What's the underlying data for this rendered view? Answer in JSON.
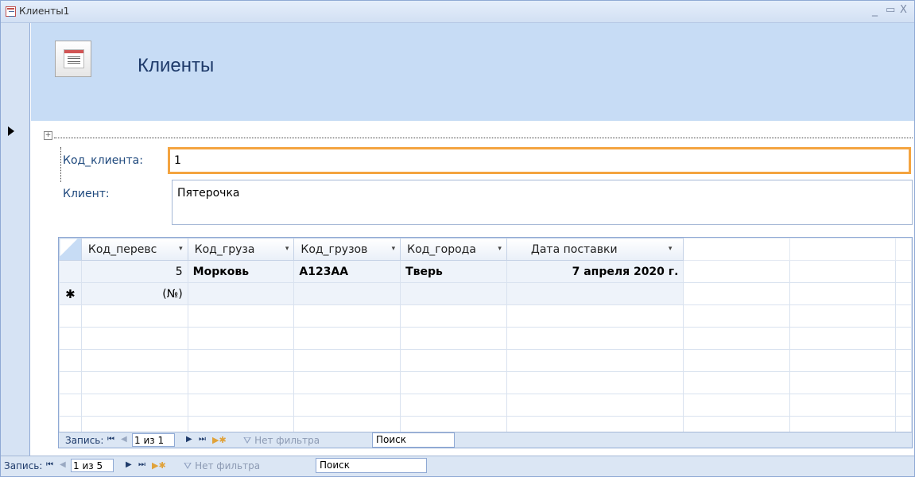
{
  "window": {
    "title": "Клиенты1",
    "minimize": "_",
    "maximize": "▭",
    "close": "X"
  },
  "header": {
    "form_title": "Клиенты",
    "icon": "form-icon"
  },
  "fields": {
    "kod_label": "Код_клиента:",
    "kod_value": "1",
    "client_label": "Клиент:",
    "client_value": "Пятерочка"
  },
  "subform": {
    "columns": [
      "Код_перевс",
      "Код_груза",
      "Код_грузов",
      "Код_города",
      "Дата поставки"
    ],
    "rows": [
      [
        "5",
        "Морковь",
        "А123АА",
        "Тверь",
        "7 апреля 2020 г."
      ]
    ],
    "new_row_marker": "✱",
    "new_row_placeholder": "(№)",
    "nav": {
      "record_label": "Запись:",
      "position": "1 из 1",
      "filter": "Нет фильтра",
      "search": "Поиск"
    }
  },
  "main_nav": {
    "record_label": "Запись:",
    "position": "1 из 5",
    "filter": "Нет фильтра",
    "search": "Поиск"
  },
  "colors": {
    "accent_focus": "#f4a440",
    "header_bg": "#c7dcf5",
    "label_color": "#1f497d"
  }
}
